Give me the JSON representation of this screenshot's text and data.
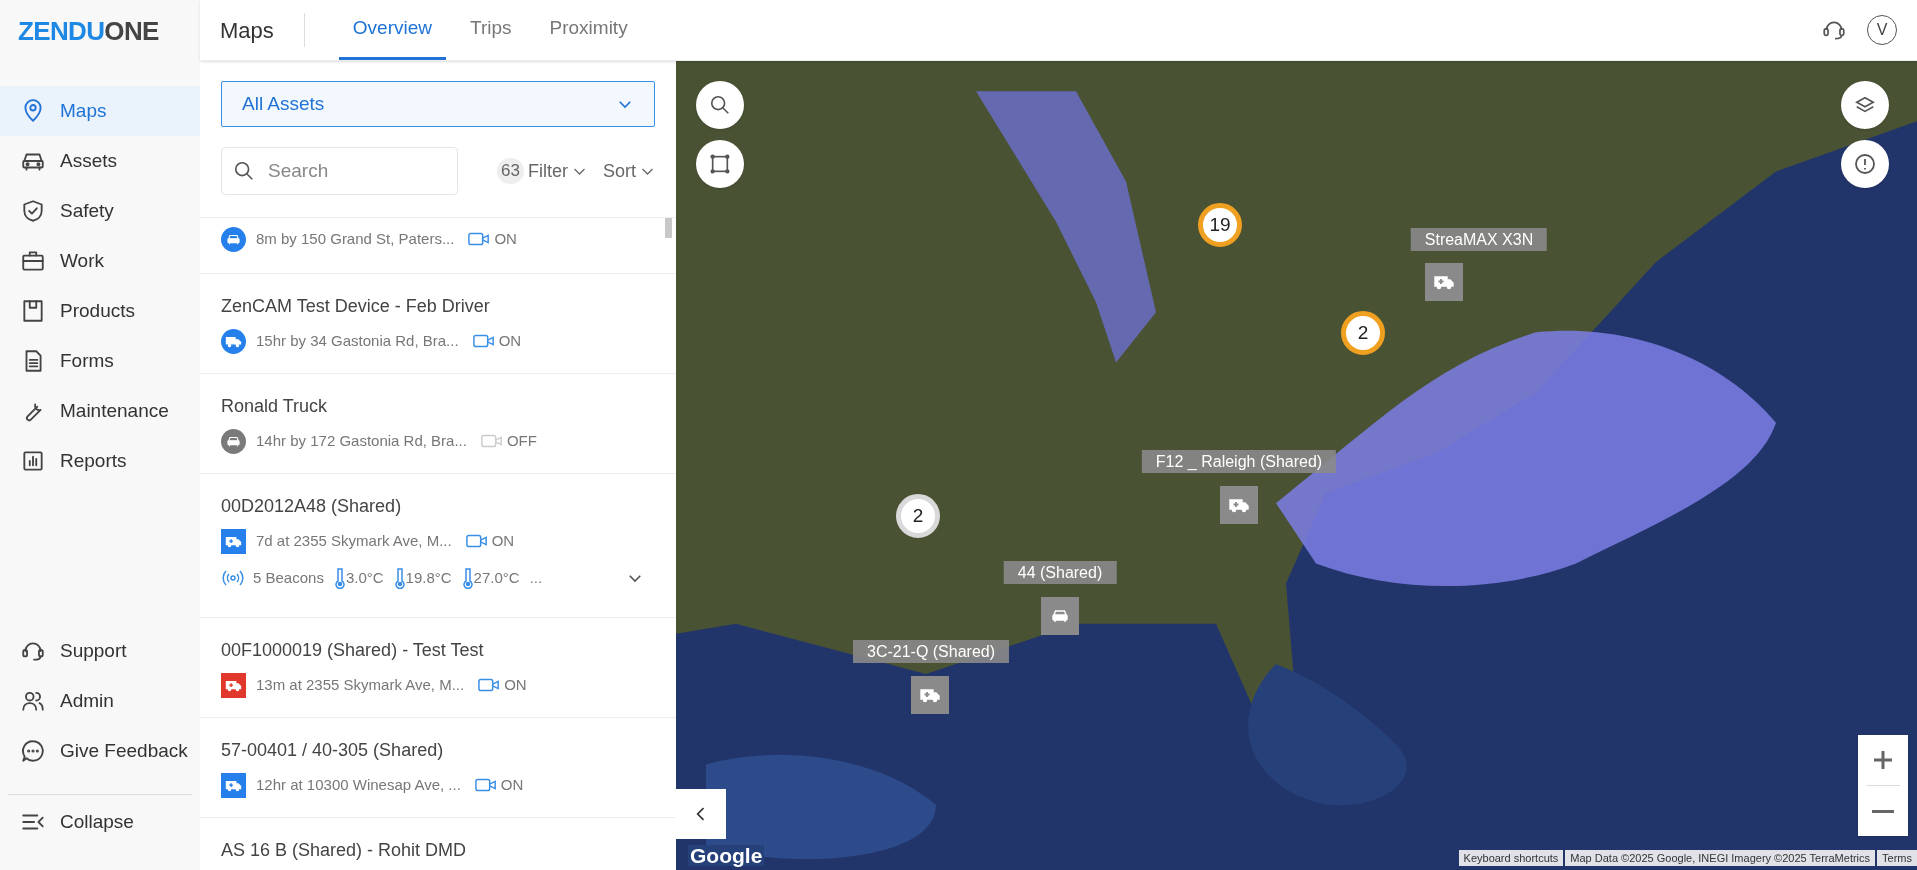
{
  "logo": {
    "part_1": "ZENDU",
    "part_2": "ONE"
  },
  "header": {
    "title": "Maps",
    "avatar": "V"
  },
  "tabs": [
    {
      "label": "Overview",
      "selected": true
    },
    {
      "label": "Trips",
      "selected": false
    },
    {
      "label": "Proximity",
      "selected": false
    }
  ],
  "sidebar": {
    "items": [
      {
        "label": "Maps",
        "selected": true
      },
      {
        "label": "Assets",
        "selected": false
      },
      {
        "label": "Safety",
        "selected": false
      },
      {
        "label": "Work",
        "selected": false
      },
      {
        "label": "Products",
        "selected": false
      },
      {
        "label": "Forms",
        "selected": false
      },
      {
        "label": "Maintenance",
        "selected": false
      },
      {
        "label": "Reports",
        "selected": false
      }
    ],
    "bottom_items": [
      {
        "label": "Support"
      },
      {
        "label": "Admin"
      },
      {
        "label": "Give Feedback"
      }
    ],
    "collapse": "Collapse"
  },
  "asset_filter": {
    "value": "All Assets"
  },
  "search": {
    "placeholder": "Search"
  },
  "filter": {
    "count": "63",
    "label": "Filter"
  },
  "sort": {
    "label": "Sort"
  },
  "assets": [
    {
      "kind": "car",
      "color": "#2680eb",
      "detail": "8m by 150 Grand St, Paters...",
      "camera_on": true,
      "camera": "ON"
    },
    {
      "name": "ZenCAM Test Device - Feb Driver",
      "kind": "truck",
      "color": "#2680eb",
      "detail": "15hr by 34 Gastonia Rd, Bra...",
      "camera_on": true,
      "camera": "ON"
    },
    {
      "name": "Ronald Truck",
      "kind": "car",
      "color": "#7a7a7a",
      "detail": "14hr by 172 Gastonia Rd, Bra...",
      "camera_on": false,
      "camera": "OFF"
    },
    {
      "name": "00D2012A48 (Shared)",
      "kind": "van",
      "color": "#2680eb",
      "detail": "7d at 2355 Skymark Ave, M...",
      "camera_on": true,
      "camera": "ON",
      "expanded": false,
      "sensors": {
        "beacons": "5 Beacons",
        "temperatures": [
          "3.0°C",
          "19.8°C",
          "27.0°C"
        ],
        "more": "..."
      }
    },
    {
      "name": "00F1000019 (Shared) - Test Test",
      "kind": "van",
      "color": "#e0392b",
      "detail": "13m at 2355 Skymark Ave, M...",
      "camera_on": true,
      "camera": "ON"
    },
    {
      "name": "57-00401 / 40-305 (Shared)",
      "kind": "van",
      "color": "#2680eb",
      "detail": "12hr at 10300 Winesap Ave, ...",
      "camera_on": true,
      "camera": "ON"
    },
    {
      "name": "AS 16 B (Shared) - Rohit DMD"
    }
  ],
  "map": {
    "clusters": [
      {
        "count": "19",
        "color": "#f0a020"
      },
      {
        "count": "2",
        "color": "#f0a020"
      },
      {
        "count": "2",
        "color": "#d9d9d9"
      }
    ],
    "markers": [
      {
        "label": "StreaMAX X3N",
        "kind": "van"
      },
      {
        "label": "F12 _ Raleigh (Shared)",
        "kind": "van"
      },
      {
        "label": "44 (Shared)",
        "kind": "car"
      },
      {
        "label": "3C-21-Q (Shared)",
        "kind": "van"
      }
    ],
    "logo": "Google",
    "attribution": [
      "Keyboard shortcuts",
      "Map Data ©2025 Google, INEGI Imagery ©2025 TerraMetrics",
      "Terms"
    ]
  }
}
